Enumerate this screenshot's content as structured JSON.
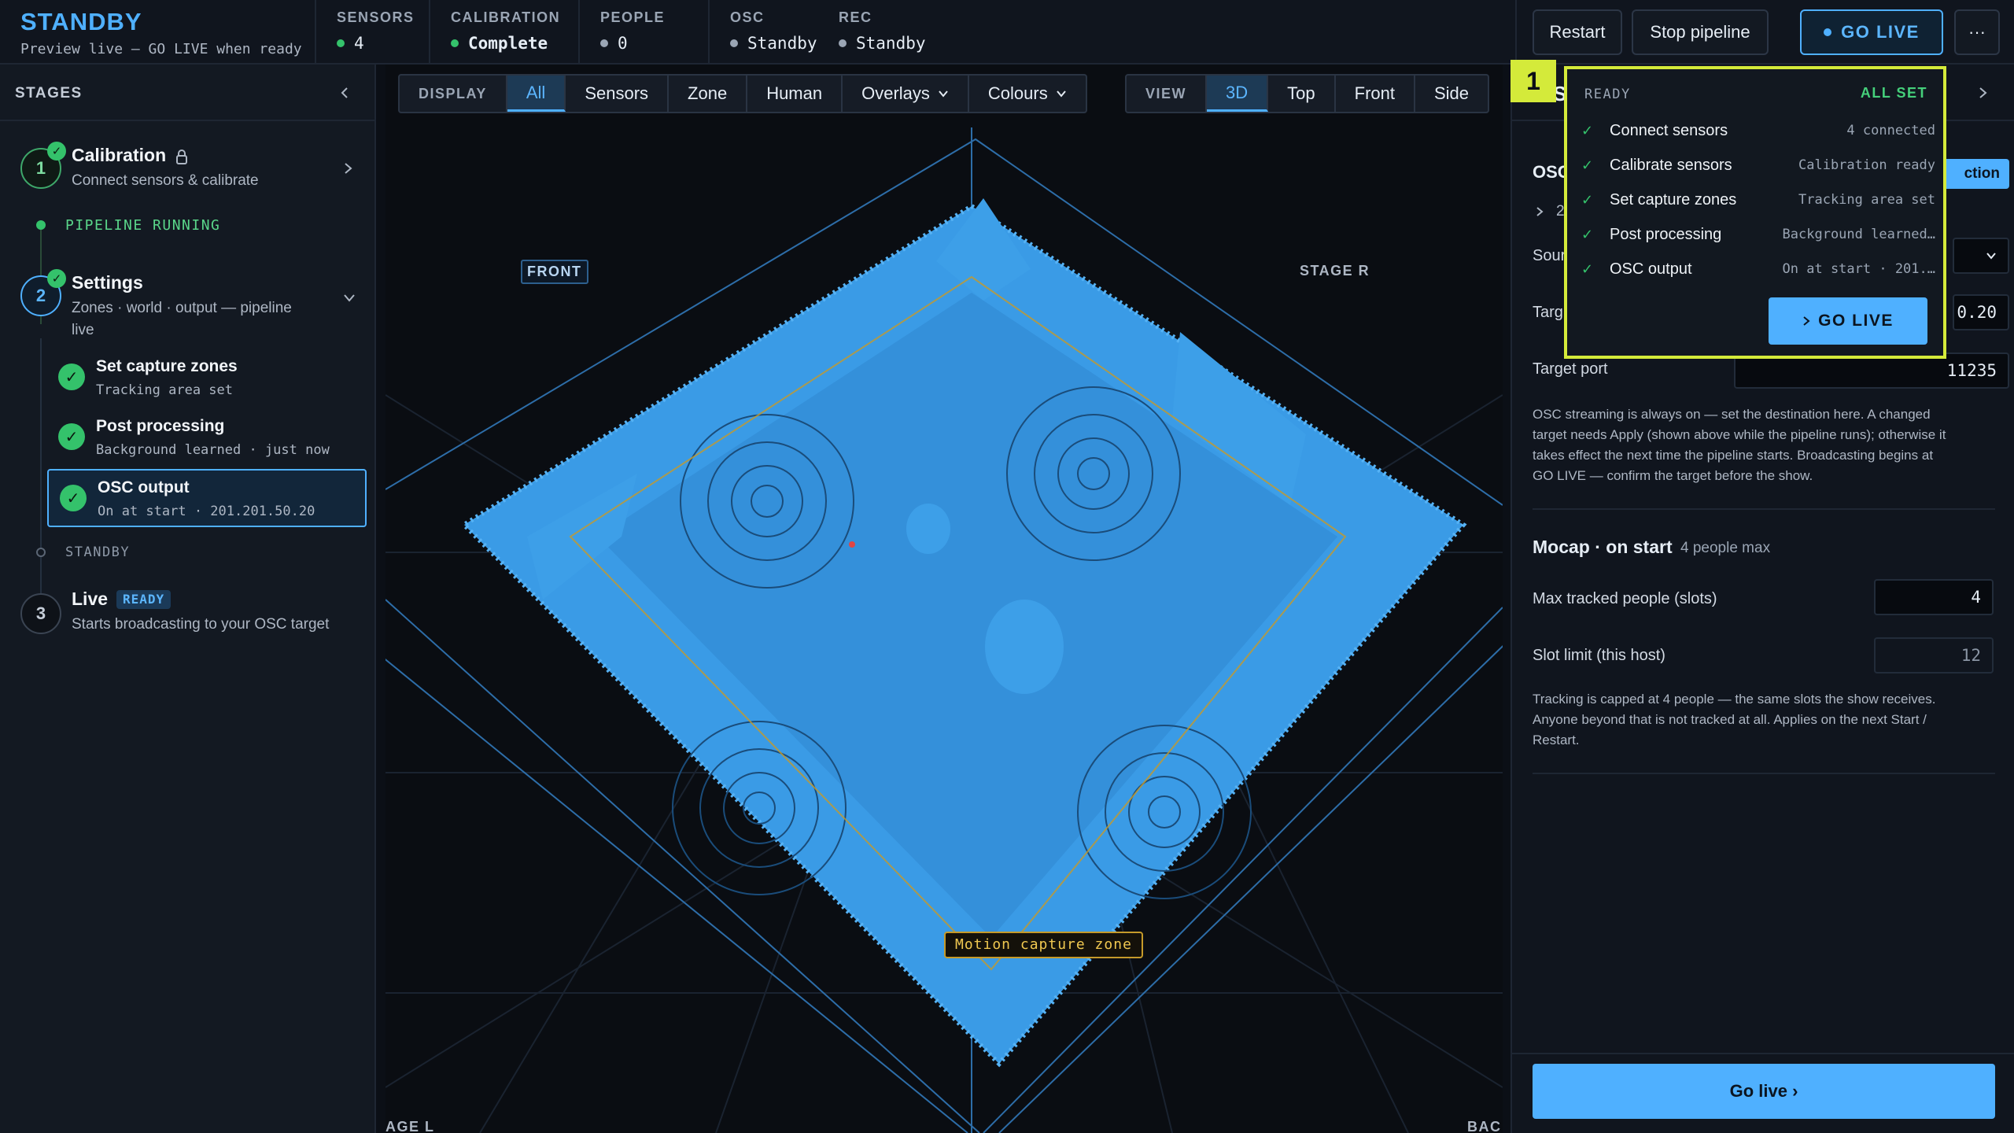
{
  "header": {
    "title": "STANDBY",
    "subtitle": "Preview live — GO LIVE when ready",
    "stats": [
      {
        "label": "SENSORS",
        "value": "4",
        "dot_color": "#34c26b"
      },
      {
        "label": "CALIBRATION",
        "value": "Complete",
        "dot_color": "#34c26b"
      },
      {
        "label": "PEOPLE",
        "value": "0",
        "dot_color": "#9aa5b4"
      },
      {
        "label": "OSC",
        "value": "Standby",
        "dot_color": "#9aa5b4"
      },
      {
        "label": "REC",
        "value": "Standby",
        "dot_color": "#9aa5b4"
      }
    ],
    "restart_label": "Restart",
    "stop_label": "Stop pipeline",
    "go_live_label": "GO LIVE",
    "more_label": "···"
  },
  "sidebar": {
    "title": "STAGES",
    "collapse_icon": "chevron-left-icon",
    "steps": [
      {
        "number": "1",
        "title": "Calibration",
        "desc": "Connect sensors & calibrate"
      },
      {
        "number": "2",
        "title": "Settings",
        "desc_line1": "Zones · world · output — pipeline",
        "desc_line2": "live"
      },
      {
        "number": "3",
        "title": "Live",
        "badge": "READY",
        "desc": "Starts broadcasting to your OSC target"
      }
    ],
    "pipeline_status": "PIPELINE RUNNING",
    "standby_label": "STANDBY",
    "substeps": [
      {
        "title": "Set capture zones",
        "desc": "Tracking area set"
      },
      {
        "title": "Post processing",
        "desc": "Background learned · just now"
      },
      {
        "title": "OSC output",
        "desc": "On at start · 201.201.50.20"
      }
    ]
  },
  "viewport": {
    "display_label": "DISPLAY",
    "display_tabs": [
      "All",
      "Sensors",
      "Zone",
      "Human",
      "Overlays",
      "Colours"
    ],
    "view_label": "VIEW",
    "view_tabs": [
      "3D",
      "Top",
      "Front",
      "Side"
    ],
    "active_display": "All",
    "active_view": "3D",
    "front_tag": "FRONT",
    "stage_r_tag": "STAGE R",
    "stage_l_tag": "AGE L",
    "back_tag": "BAC",
    "zone_label": "Motion capture zone"
  },
  "right_panel": {
    "heading_partial": "S",
    "osc_heading_partial": "OSC",
    "action_partial": "ction",
    "expander_partial": "2",
    "source_partial": "Sour",
    "target_partial": "Targ",
    "target_host_partial": "0.20",
    "target_port_label": "Target port",
    "target_port_value": "11235",
    "osc_help": [
      "OSC streaming is always on — set the destination here. A changed",
      "target needs Apply (shown above while the pipeline runs); otherwise it",
      "takes effect the next time the pipeline starts. Broadcasting begins at",
      "GO LIVE — confirm the target before the show."
    ],
    "mocap_title": "Mocap · on start",
    "mocap_sub": "4 people max",
    "max_people_label": "Max tracked people (slots)",
    "max_people_value": "4",
    "slot_limit_label": "Slot limit (this host)",
    "slot_limit_value": "12",
    "mocap_help": [
      "Tracking is capped at 4 people — the same slots the show receives.",
      "Anyone beyond that is not tracked at all. Applies on the next Start /",
      "Restart."
    ],
    "go_live_button": "Go live ›"
  },
  "popover": {
    "marker": "1",
    "ready_label": "READY",
    "all_set_label": "ALL SET",
    "items": [
      {
        "name": "Connect sensors",
        "status": "4 connected"
      },
      {
        "name": "Calibrate sensors",
        "status": "Calibration ready"
      },
      {
        "name": "Set capture zones",
        "status": "Tracking area set"
      },
      {
        "name": "Post processing",
        "status": "Background learned…"
      },
      {
        "name": "OSC output",
        "status": "On at start · 201.…"
      }
    ],
    "go_live_label": "GO LIVE"
  },
  "colors": {
    "accent": "#4fb0ff",
    "success": "#34c26b",
    "highlight": "#d4ea3a",
    "zone": "#e0b640",
    "cloud": "#4aa8ee"
  }
}
